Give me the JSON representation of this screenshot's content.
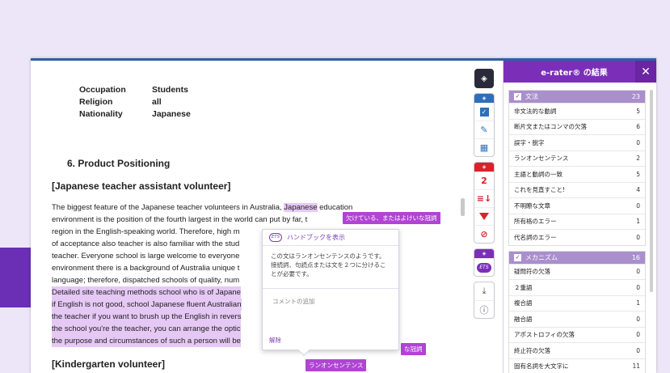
{
  "document": {
    "info": [
      {
        "key": "Occupation",
        "value": "Students"
      },
      {
        "key": "Religion",
        "value": "all"
      },
      {
        "key": "Nationality",
        "value": "Japanese"
      }
    ],
    "section_title": "6.  Product Positioning",
    "sub_heading": "[Japanese teacher assistant volunteer]",
    "sub_heading_2": "[Kindergarten volunteer]",
    "lines": [
      {
        "pre": "The biggest feature of the Japanese teacher volunteers in Australia, ",
        "hl": "Japanese",
        "post": " education",
        "full": false
      },
      {
        "pre": "environment is the position of the fourth largest in the world can put by far, t",
        "hl": "",
        "post": "",
        "full": false
      },
      {
        "pre": "region in the English-speaking world. Therefore, high m",
        "hl": "",
        "post": "",
        "full": false
      },
      {
        "pre": "of acceptance also teacher is also familiar with the stud",
        "hl": "",
        "post": "",
        "full": false
      },
      {
        "pre": "teacher. Everyone school is large welcome to everyone",
        "hl": "",
        "post": "",
        "full": false
      },
      {
        "pre": "environment there is a background of Australia unique t",
        "hl": "",
        "post": "",
        "full": false
      },
      {
        "pre": "language; therefore, dispatched schools of quality, num",
        "hl": "",
        "post": "",
        "full": false
      },
      {
        "pre": "Detailed site teaching methods school who is of Japane",
        "hl": "",
        "post": "",
        "full": true
      },
      {
        "pre": "if English is not good, school Japanese fluent Australian",
        "hl": "",
        "post": "",
        "full": true
      },
      {
        "pre": "the teacher if you want to brush up the English in revers",
        "hl": "",
        "post": "",
        "full": true
      },
      {
        "pre": "the school you're the teacher, you can arrange the optic",
        "hl": "",
        "post": "",
        "full": true
      },
      {
        "pre": "the purpose and circumstances of such a person will be",
        "hl": "",
        "post": "",
        "full": true
      }
    ]
  },
  "tags": {
    "missing_article": "欠けている、またはよけいな冠詞",
    "article_short": "な冠詞",
    "run_on": "ランオンセンテンス"
  },
  "popup": {
    "ets": "ETS",
    "handbook": "ハンドブックを表示",
    "message": "この文はランオンセンテンスのようです。接続詞、句読点または文を２つに分けることが必要です。",
    "comment_placeholder": "コメントの追加",
    "dismiss": "解除"
  },
  "toolbar": {
    "red_count": "2",
    "ets": "ETS"
  },
  "panel": {
    "title": "e-rater® の結果",
    "close": "✕",
    "categories": [
      {
        "name": "文法",
        "count": "23",
        "items": [
          {
            "label": "非文法的な動詞",
            "count": "5"
          },
          {
            "label": "断片文またはコンマの欠落",
            "count": "6"
          },
          {
            "label": "誤字・脱字",
            "count": "0"
          },
          {
            "label": "ランオンセンテンス",
            "count": "2"
          },
          {
            "label": "主語と動詞の一致",
            "count": "5"
          },
          {
            "label": "これを見直すこと!",
            "count": "4"
          },
          {
            "label": "不明瞭な文章",
            "count": "0"
          },
          {
            "label": "所有格のエラー",
            "count": "1"
          },
          {
            "label": "代名詞のエラー",
            "count": "0"
          }
        ]
      },
      {
        "name": "メカニズム",
        "count": "16",
        "items": [
          {
            "label": "疑問符の欠落",
            "count": "0"
          },
          {
            "label": "２重語",
            "count": "0"
          },
          {
            "label": "複合語",
            "count": "1"
          },
          {
            "label": "融合語",
            "count": "0"
          },
          {
            "label": "アポストロフィの欠落",
            "count": "0"
          },
          {
            "label": "終止符の欠落",
            "count": "0"
          },
          {
            "label": "固有名詞を大文字に",
            "count": "11"
          }
        ]
      }
    ]
  },
  "colors": {
    "accent": "#7b2fb8",
    "highlight": "#e6c8f5",
    "error_red": "#d8232a",
    "info_blue": "#2f6fb8"
  }
}
